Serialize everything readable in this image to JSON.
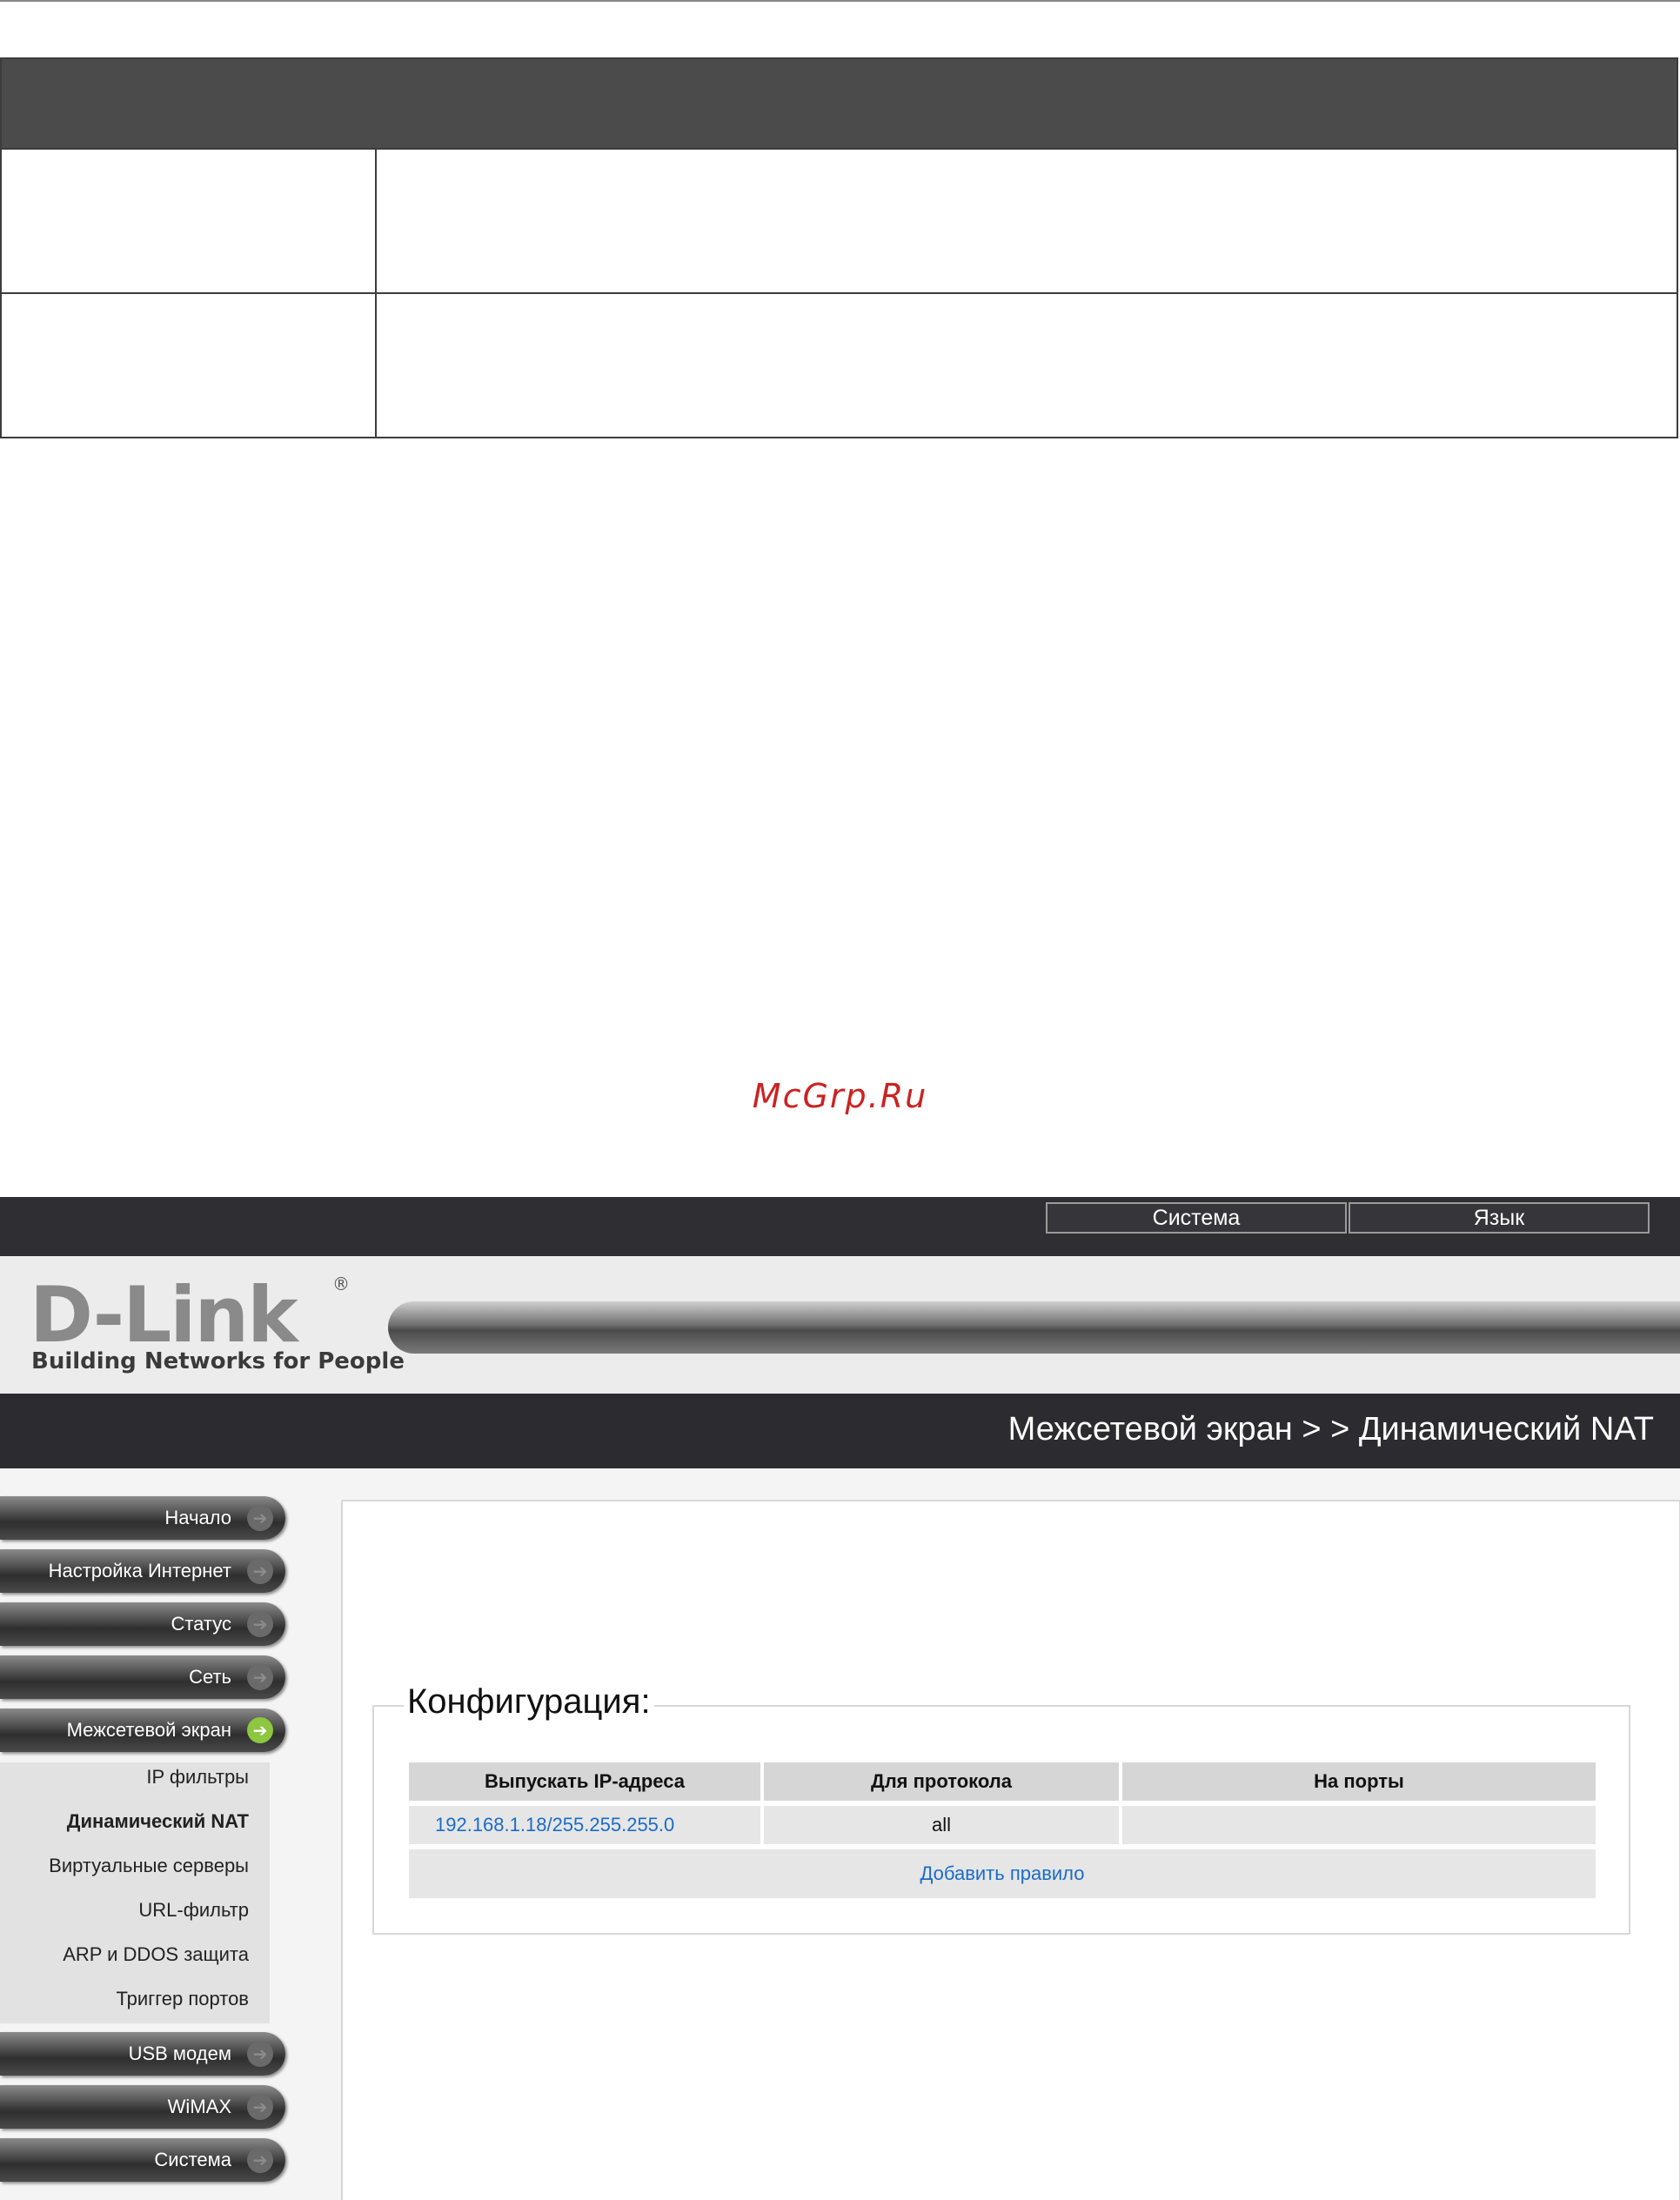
{
  "watermark": "McGrp.Ru",
  "router": {
    "top_buttons": [
      "Система",
      "Язык"
    ],
    "logo_text": "D-Link",
    "logo_registered": "®",
    "logo_tagline": "Building Networks for People",
    "breadcrumb": "Межсетевой экран > > Динамический NAT",
    "sidebar": {
      "items_top": [
        "Начало",
        "Настройка Интернет",
        "Статус",
        "Сеть",
        "Межсетевой экран"
      ],
      "subitems": [
        "IP фильтры",
        "Динамический NAT",
        "Виртуальные серверы",
        "URL-фильтр",
        "ARP и DDOS защита",
        "Триггер портов"
      ],
      "items_bottom": [
        "USB модем",
        "WiMAX",
        "Система"
      ]
    },
    "config": {
      "legend": "Конфигурация:",
      "headers": [
        "Выпускать IP-адреса",
        "Для протокола",
        "На порты"
      ],
      "rows": [
        [
          "192.168.1.18/255.255.255.0",
          "all",
          ""
        ]
      ],
      "add_rule": "Добавить правило"
    }
  }
}
